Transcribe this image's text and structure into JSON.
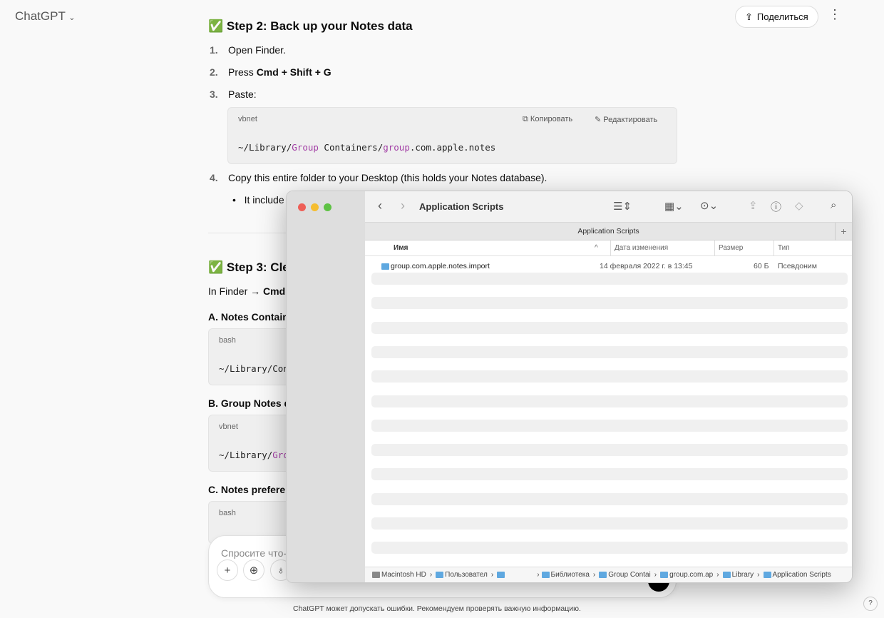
{
  "header": {
    "brand": "ChatGPT",
    "share": "Поделиться"
  },
  "step2": {
    "title": "✅ Step 2: Back up your Notes data",
    "items": [
      {
        "n": "1.",
        "pre": "Open Finder.",
        "bold": ""
      },
      {
        "n": "2.",
        "pre": "Press ",
        "bold": "Cmd + Shift + G"
      },
      {
        "n": "3.",
        "pre": "Paste:",
        "bold": ""
      },
      {
        "n": "4.",
        "pre": "Copy this entire folder to your Desktop (this holds your Notes database).",
        "bold": ""
      }
    ],
    "code": {
      "lang": "vbnet",
      "copy": "Копировать",
      "edit": "Редактировать",
      "p1": "~/Library/",
      "k1": "Group",
      "p2": " Containers/",
      "k2": "group",
      "p3": ".com.apple.notes"
    },
    "bullet": "It include"
  },
  "step3": {
    "title": "✅ Step 3: Cle",
    "intro_pre": "In Finder → ",
    "intro_bold": "Cmd -",
    "a": {
      "title": "A. Notes Contain",
      "lang": "bash",
      "code": "~/Library/Con"
    },
    "b": {
      "title": "B. Group Notes d",
      "lang": "vbnet",
      "code_pre": "~/Library/",
      "code_kw": "Gro"
    },
    "c": {
      "title": "C. Notes preferen",
      "lang": "bash"
    }
  },
  "composer": {
    "placeholder": "Спросите что-"
  },
  "footer": "ChatGPT может допускать ошибки. Рекомендуем проверять важную информацию.",
  "help": "?",
  "finder": {
    "title": "Application Scripts",
    "tab": "Application Scripts",
    "columns": [
      "Имя",
      "Дата изменения",
      "Размер",
      "Тип"
    ],
    "rows": [
      {
        "name": "group.com.apple.notes.import",
        "date": "14 февраля 2022 г. в 13:45",
        "size": "60 Б",
        "kind": "Псевдоним"
      }
    ],
    "path": [
      "Macintosh HD",
      "Пользовател",
      "",
      "Библиотека",
      "Group Contai",
      "group.com.ap",
      "Library",
      "Application Scripts"
    ]
  }
}
